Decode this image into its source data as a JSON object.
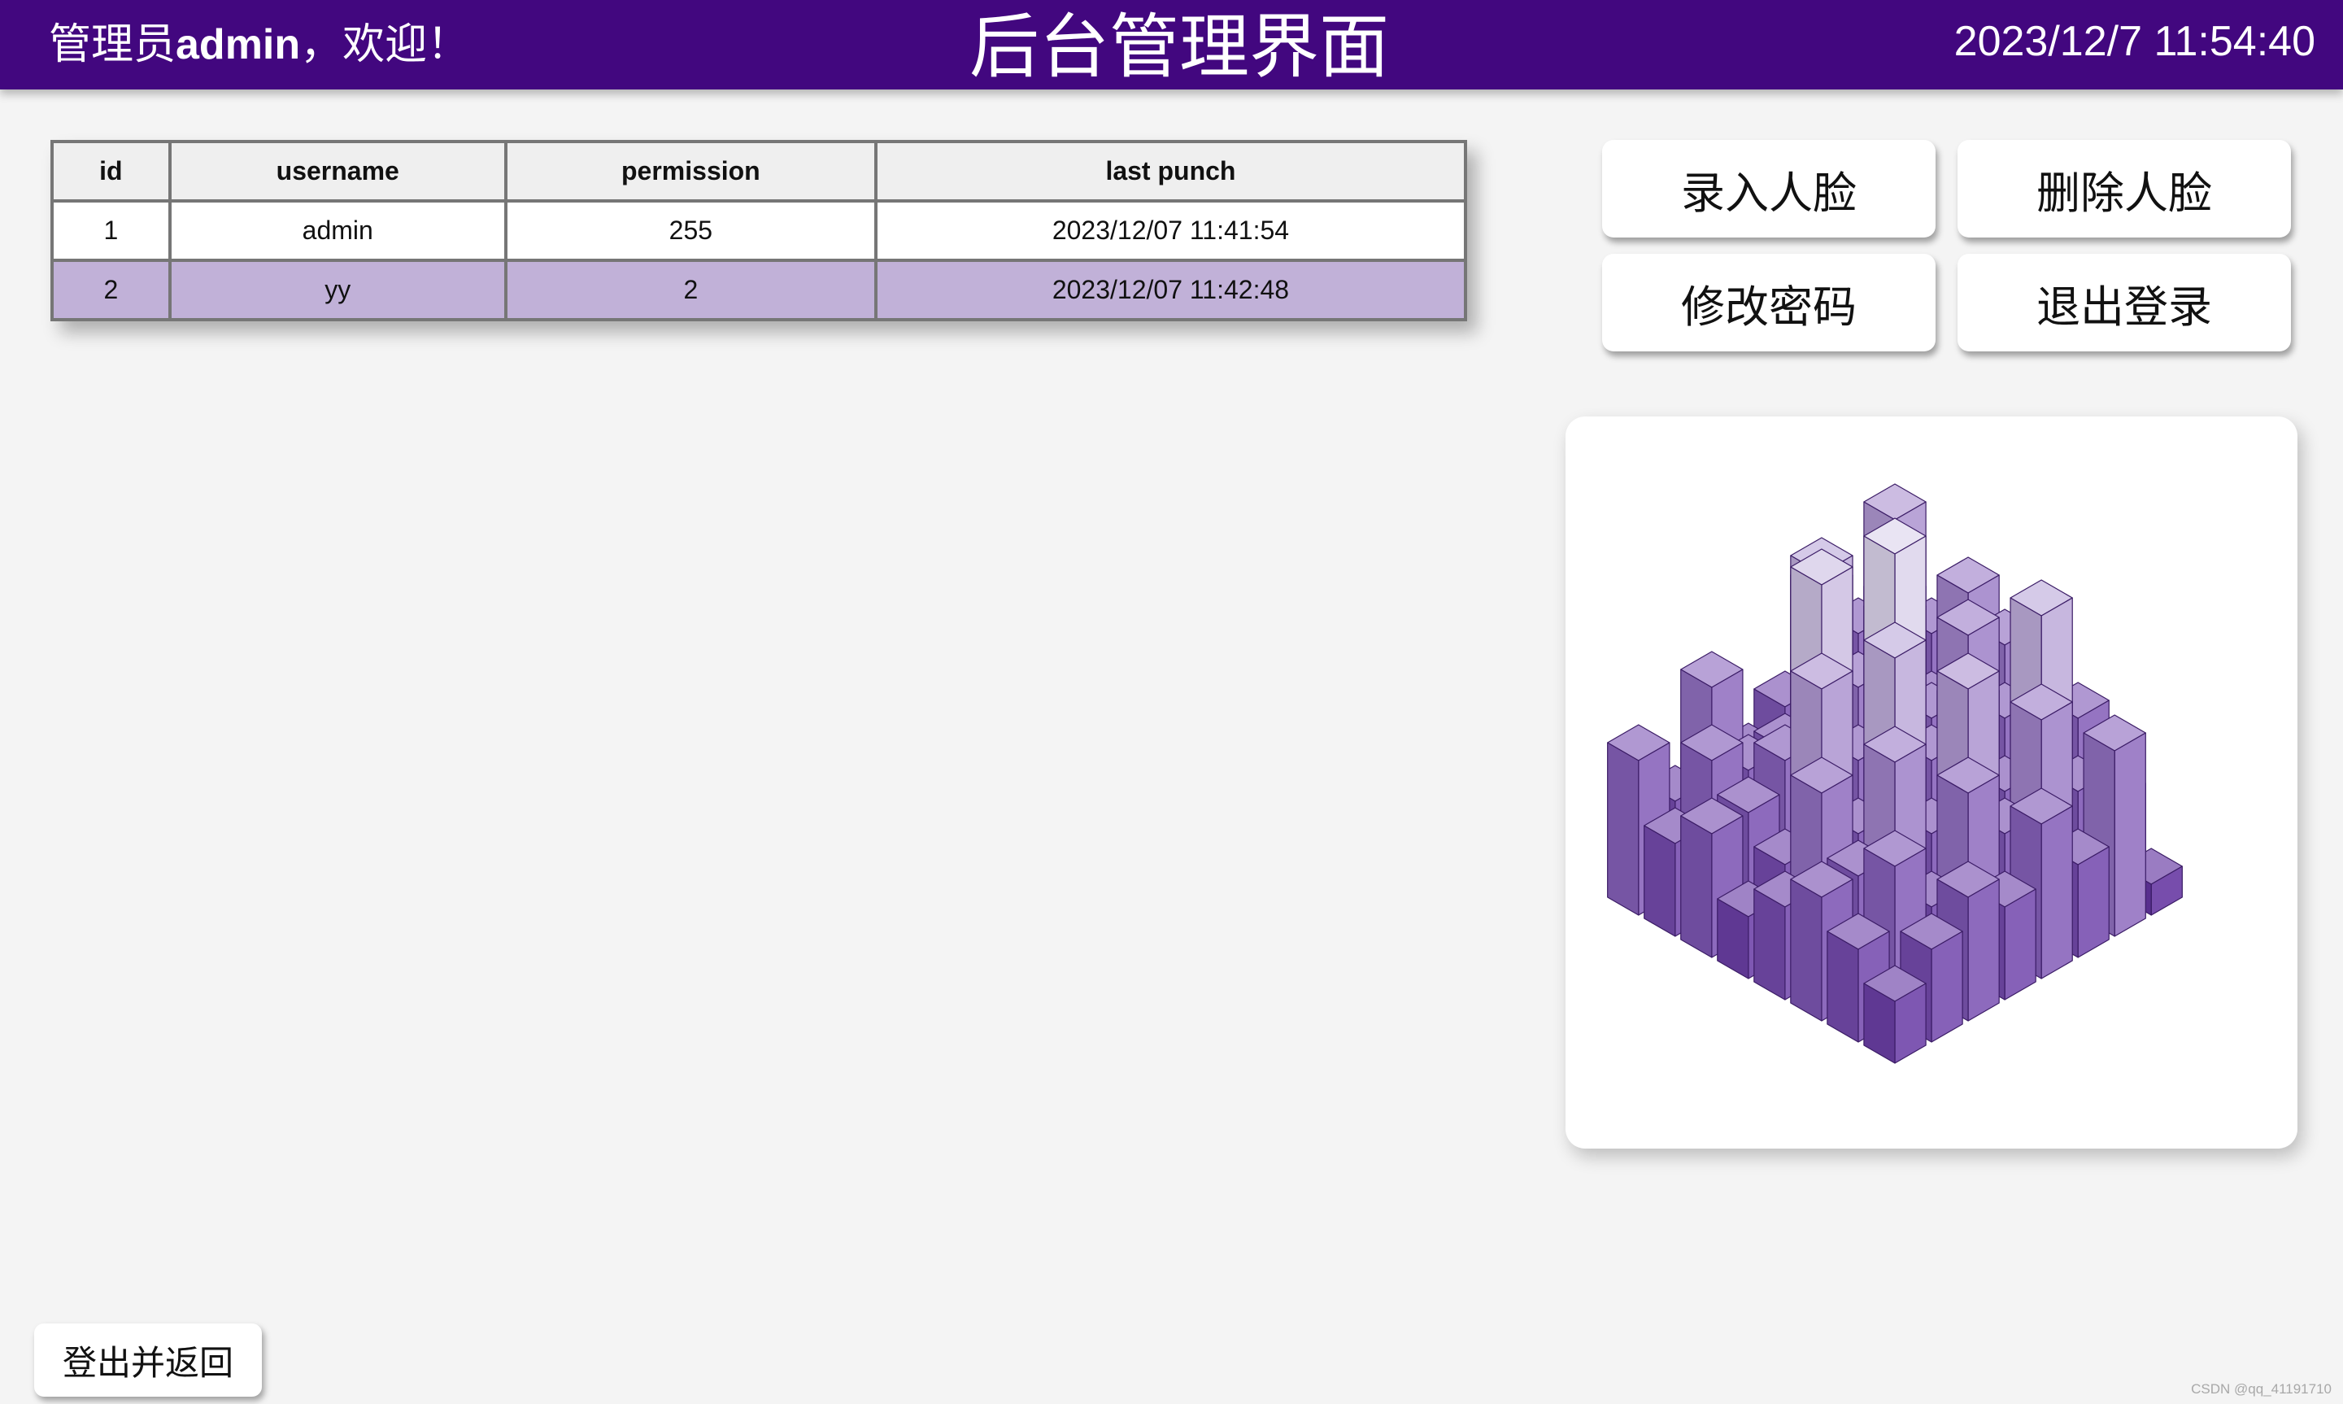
{
  "header": {
    "greeting_prefix": "管理员",
    "username": "admin",
    "greeting_suffix": "，欢迎！",
    "title": "后台管理界面",
    "datetime": "2023/12/7 11:54:40"
  },
  "table": {
    "columns": [
      "id",
      "username",
      "permission",
      "last punch"
    ],
    "rows": [
      [
        "1",
        "admin",
        "255",
        "2023/12/07 11:41:54"
      ],
      [
        "2",
        "yy",
        "2",
        "2023/12/07 11:42:48"
      ]
    ]
  },
  "actions": {
    "enroll_face": "录入人脸",
    "delete_face": "删除人脸",
    "change_password": "修改密码",
    "logout": "退出登录"
  },
  "footer": {
    "logout_return": "登出并返回",
    "watermark": "CSDN @qq_41191710"
  },
  "colors": {
    "header_bg": "#42077f",
    "row_highlight": "#c1b1d8",
    "bar_dark": "#5b2a9b",
    "bar_mid": "#8a66bd",
    "bar_light": "#ddd5ec"
  },
  "icons": {
    "decoration": "isometric-3d-bar-chart-icon"
  },
  "decoration_grid": [
    [
      2,
      3,
      4,
      3,
      2,
      4,
      3,
      5
    ],
    [
      3,
      5,
      4,
      6,
      3,
      4,
      5,
      3
    ],
    [
      4,
      3,
      7,
      4,
      8,
      5,
      4,
      6
    ],
    [
      3,
      6,
      4,
      9,
      5,
      10,
      4,
      3
    ],
    [
      5,
      4,
      8,
      5,
      11,
      6,
      9,
      4
    ],
    [
      3,
      7,
      4,
      6,
      5,
      8,
      4,
      7
    ],
    [
      6,
      4,
      9,
      5,
      7,
      4,
      6,
      5
    ],
    [
      1,
      3,
      5,
      4,
      6,
      7,
      5,
      8
    ]
  ]
}
